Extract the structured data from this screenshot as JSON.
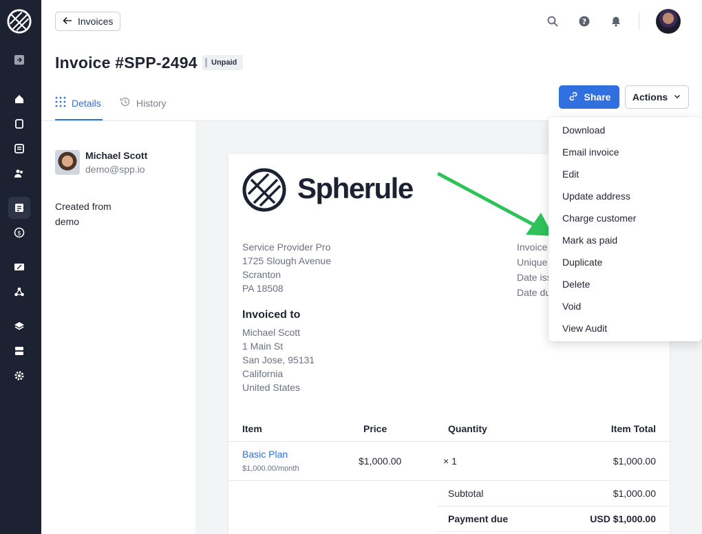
{
  "header": {
    "back_label": "Invoices",
    "title": "Invoice #SPP-2494",
    "status": "Unpaid"
  },
  "tabs": [
    {
      "label": "Details",
      "active": true
    },
    {
      "label": "History",
      "active": false
    }
  ],
  "buttons": {
    "share": "Share",
    "actions": "Actions"
  },
  "customer": {
    "name": "Michael Scott",
    "email": "demo@spp.io",
    "created_label": "Created from",
    "created_value": "demo"
  },
  "invoice": {
    "brand": "Spherule",
    "from": [
      "Service Provider Pro",
      "1725 Slough Avenue",
      "Scranton",
      "PA 18508"
    ],
    "invoiced_to_label": "Invoiced to",
    "to": [
      "Michael Scott",
      "1 Main St",
      "San Jose, 95131",
      "California",
      "United States"
    ],
    "meta_labels": [
      "Invoice",
      "Unique",
      "Date iss",
      "Date du"
    ],
    "table": {
      "headers": [
        "Item",
        "Price",
        "Quantity",
        "Item Total"
      ],
      "rows": [
        {
          "item": "Basic Plan",
          "sub": "$1,000.00/month",
          "price": "$1,000.00",
          "qty": "× 1",
          "total": "$1,000.00"
        }
      ],
      "subtotal_label": "Subtotal",
      "subtotal_value": "$1,000.00",
      "due_label": "Payment due",
      "due_value": "USD $1,000.00"
    }
  },
  "actions_menu": [
    "Download",
    "Email invoice",
    "Edit",
    "Update address",
    "Charge customer",
    "Mark as paid",
    "Duplicate",
    "Delete",
    "Void",
    "View Audit"
  ],
  "colors": {
    "sidebar": "#1c2232",
    "accent": "#2f6fdf",
    "arrow": "#2fc25b"
  }
}
